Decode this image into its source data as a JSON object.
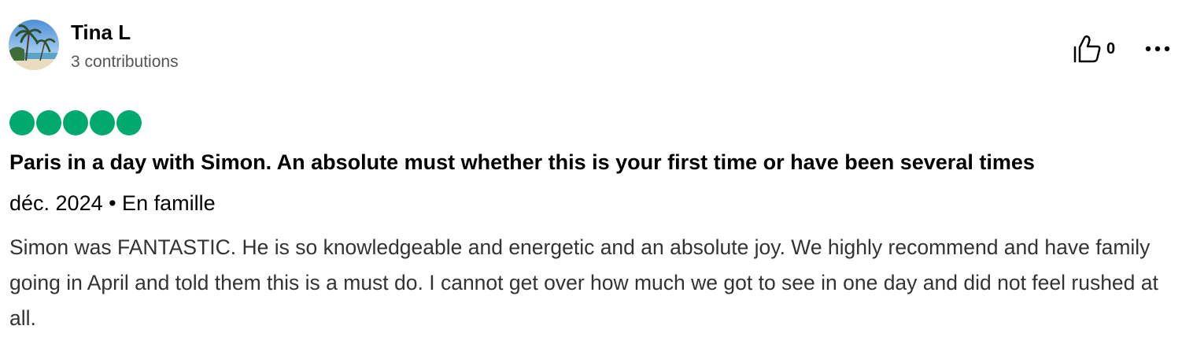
{
  "reviewer": {
    "name": "Tina L",
    "contributions": "3 contributions",
    "avatar_icon": "beach-palm-avatar"
  },
  "actions": {
    "helpful_icon": "thumbs-up-icon",
    "helpful_count": "0",
    "more_icon": "more-options-icon"
  },
  "rating": {
    "value": 5,
    "max": 5,
    "color": "#00aa6c"
  },
  "review": {
    "title": "Paris in a day with Simon. An absolute must whether this is your first time or have been several times",
    "meta": "déc. 2024 • En famille",
    "body": "Simon was FANTASTIC. He is so knowledgeable and energetic and an absolute joy. We highly recommend and have family going in April and told them this is a must do. I cannot get over how much we got to see in one day and did not feel rushed at all."
  }
}
